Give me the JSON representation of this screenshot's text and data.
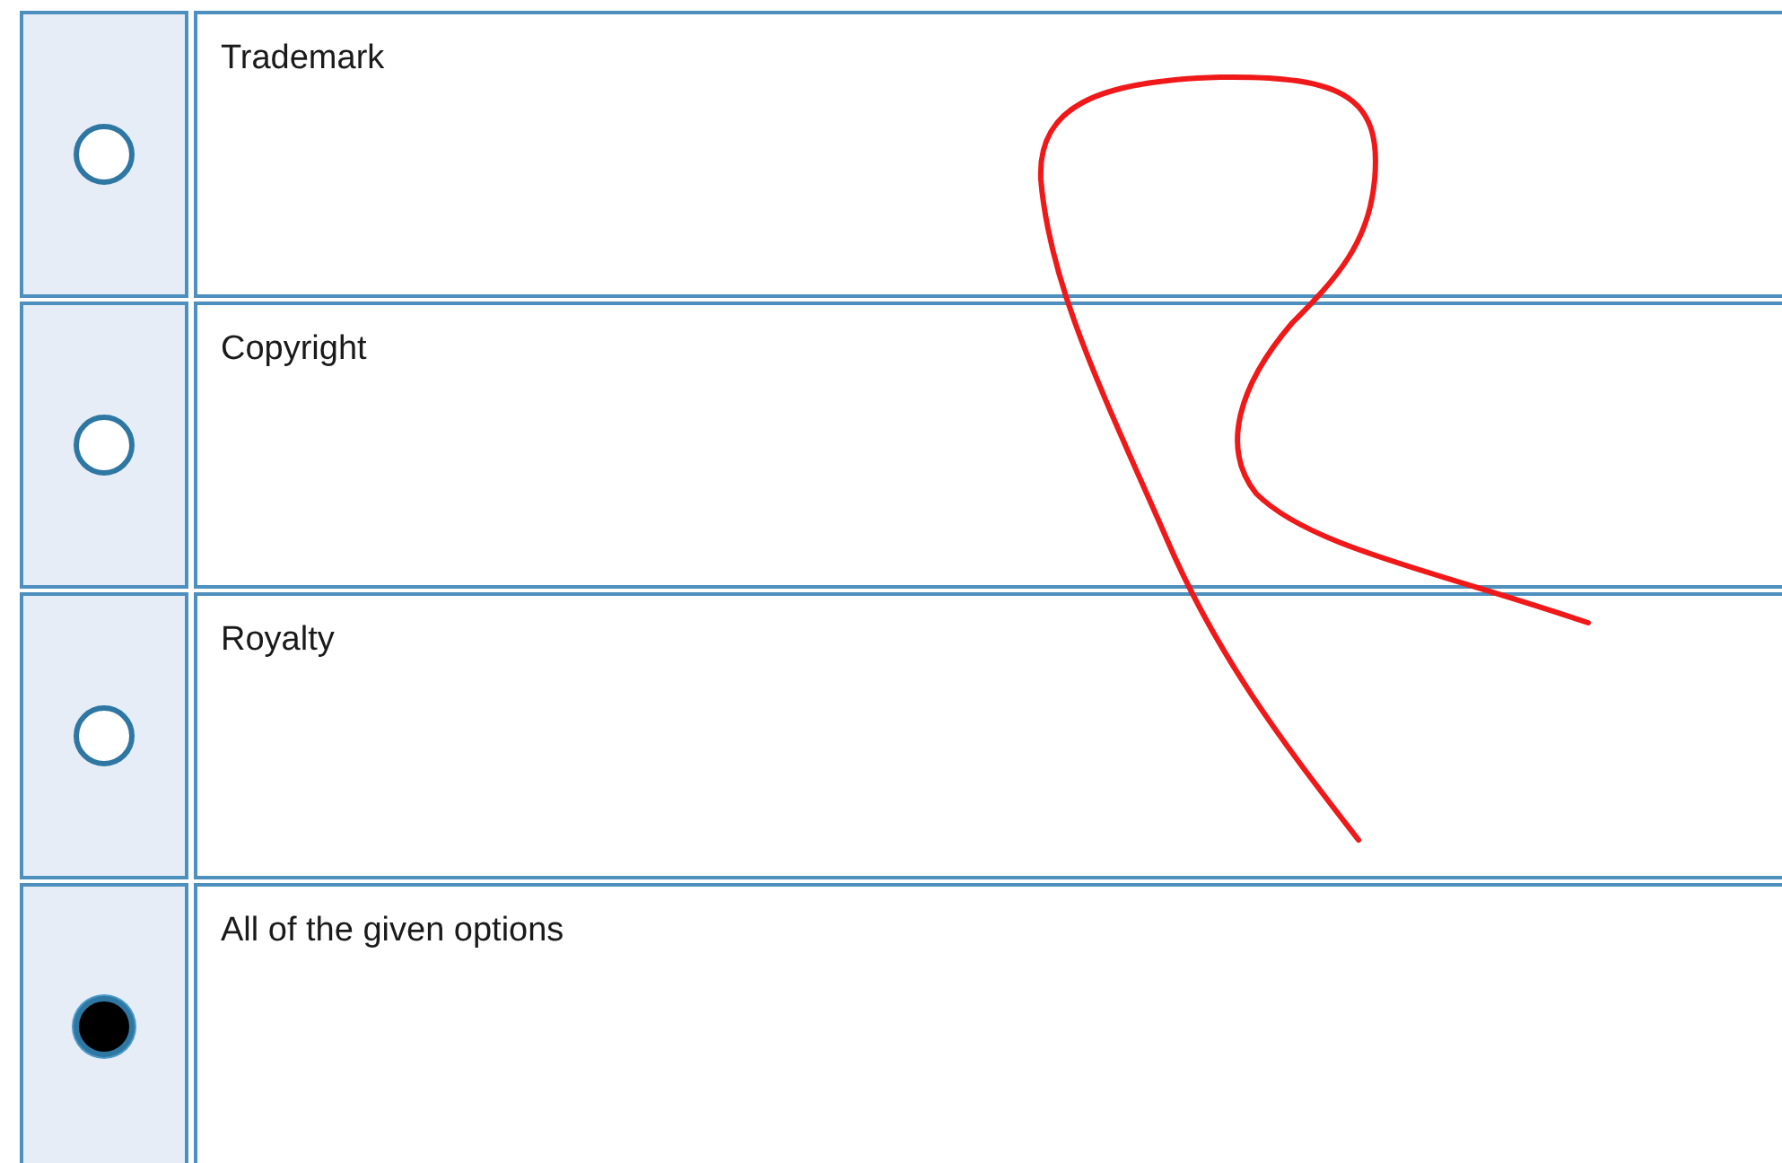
{
  "options": [
    {
      "label": "Trademark",
      "selected": false
    },
    {
      "label": "Copyright",
      "selected": false
    },
    {
      "label": "Royalty",
      "selected": false
    },
    {
      "label": "All of the given options",
      "selected": true
    }
  ]
}
